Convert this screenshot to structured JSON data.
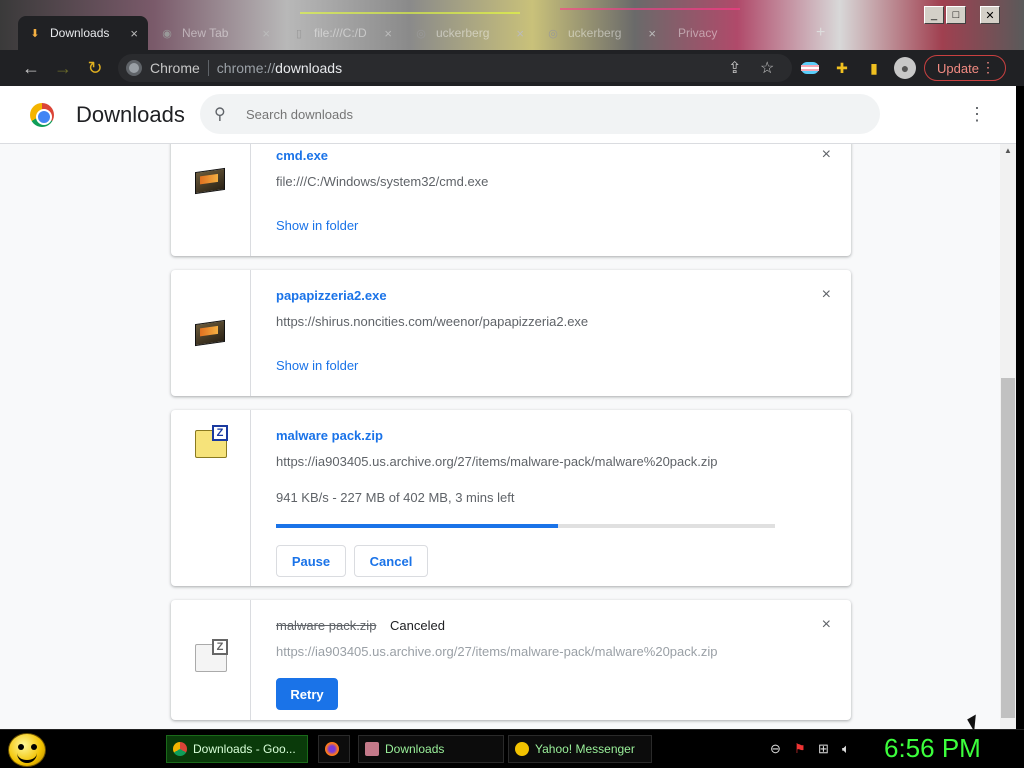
{
  "browser": {
    "tabs": [
      {
        "title": "Downloads",
        "close": "×",
        "active": true
      },
      {
        "title": "New Tab",
        "close": "×",
        "active": false
      },
      {
        "title": "file:///C:/D",
        "close": "×",
        "active": false
      },
      {
        "title": "uckerberg",
        "close": "×",
        "active": false
      },
      {
        "title": "uckerberg",
        "close": "×",
        "active": false
      },
      {
        "title": "Privacy",
        "close": "",
        "active": false
      }
    ],
    "new_tab": "+",
    "window_buttons": {
      "minimize": "_",
      "maximize": "□",
      "close": "✕"
    },
    "nav": {
      "back": "←",
      "forward": "→",
      "reload": "↻"
    },
    "omnibox": {
      "site_name": "Chrome",
      "url_scheme": "chrome://",
      "url_host": "downloads"
    },
    "update_label": "Update",
    "menu_dots": "⋮"
  },
  "page": {
    "title": "Downloads",
    "search_placeholder": "Search downloads",
    "search_icon": "⚲",
    "more_icon": "⋮"
  },
  "downloads": [
    {
      "filename": "cmd.exe",
      "url": "file:///C:/Windows/system32/cmd.exe",
      "link": "Show in folder",
      "close": "×",
      "icon": "exe-icon"
    },
    {
      "filename": "papapizzeria2.exe",
      "url": "https://shirus.noncities.com/weenor/papapizzeria2.exe",
      "link": "Show in folder",
      "close": "×",
      "icon": "exe-icon"
    },
    {
      "filename": "malware pack.zip",
      "url": "https://ia903405.us.archive.org/27/items/malware-pack/malware%20pack.zip",
      "progress_text": "941 KB/s - 227 MB of 402 MB, 3 mins left",
      "progress": 0.565,
      "pause_label": "Pause",
      "cancel_label": "Cancel",
      "icon": "zip-icon"
    },
    {
      "filename": "malware pack.zip",
      "status": "Canceled",
      "url": "https://ia903405.us.archive.org/27/items/malware-pack/malware%20pack.zip",
      "retry_label": "Retry",
      "close": "×",
      "icon": "zip-icon"
    }
  ],
  "taskbar": {
    "items": [
      {
        "label": "Downloads - Goo...",
        "icon": "chrome-icon"
      },
      {
        "label": "",
        "icon": "firefox-icon"
      },
      {
        "label": "Downloads",
        "icon": "folder-icon"
      },
      {
        "label": "Yahoo! Messenger",
        "icon": "yahoo-messenger-icon"
      }
    ],
    "clock": "6:56 PM"
  },
  "colors": {
    "accent": "#1a73e8",
    "clock": "#3cff3c",
    "update": "#f28b82"
  }
}
